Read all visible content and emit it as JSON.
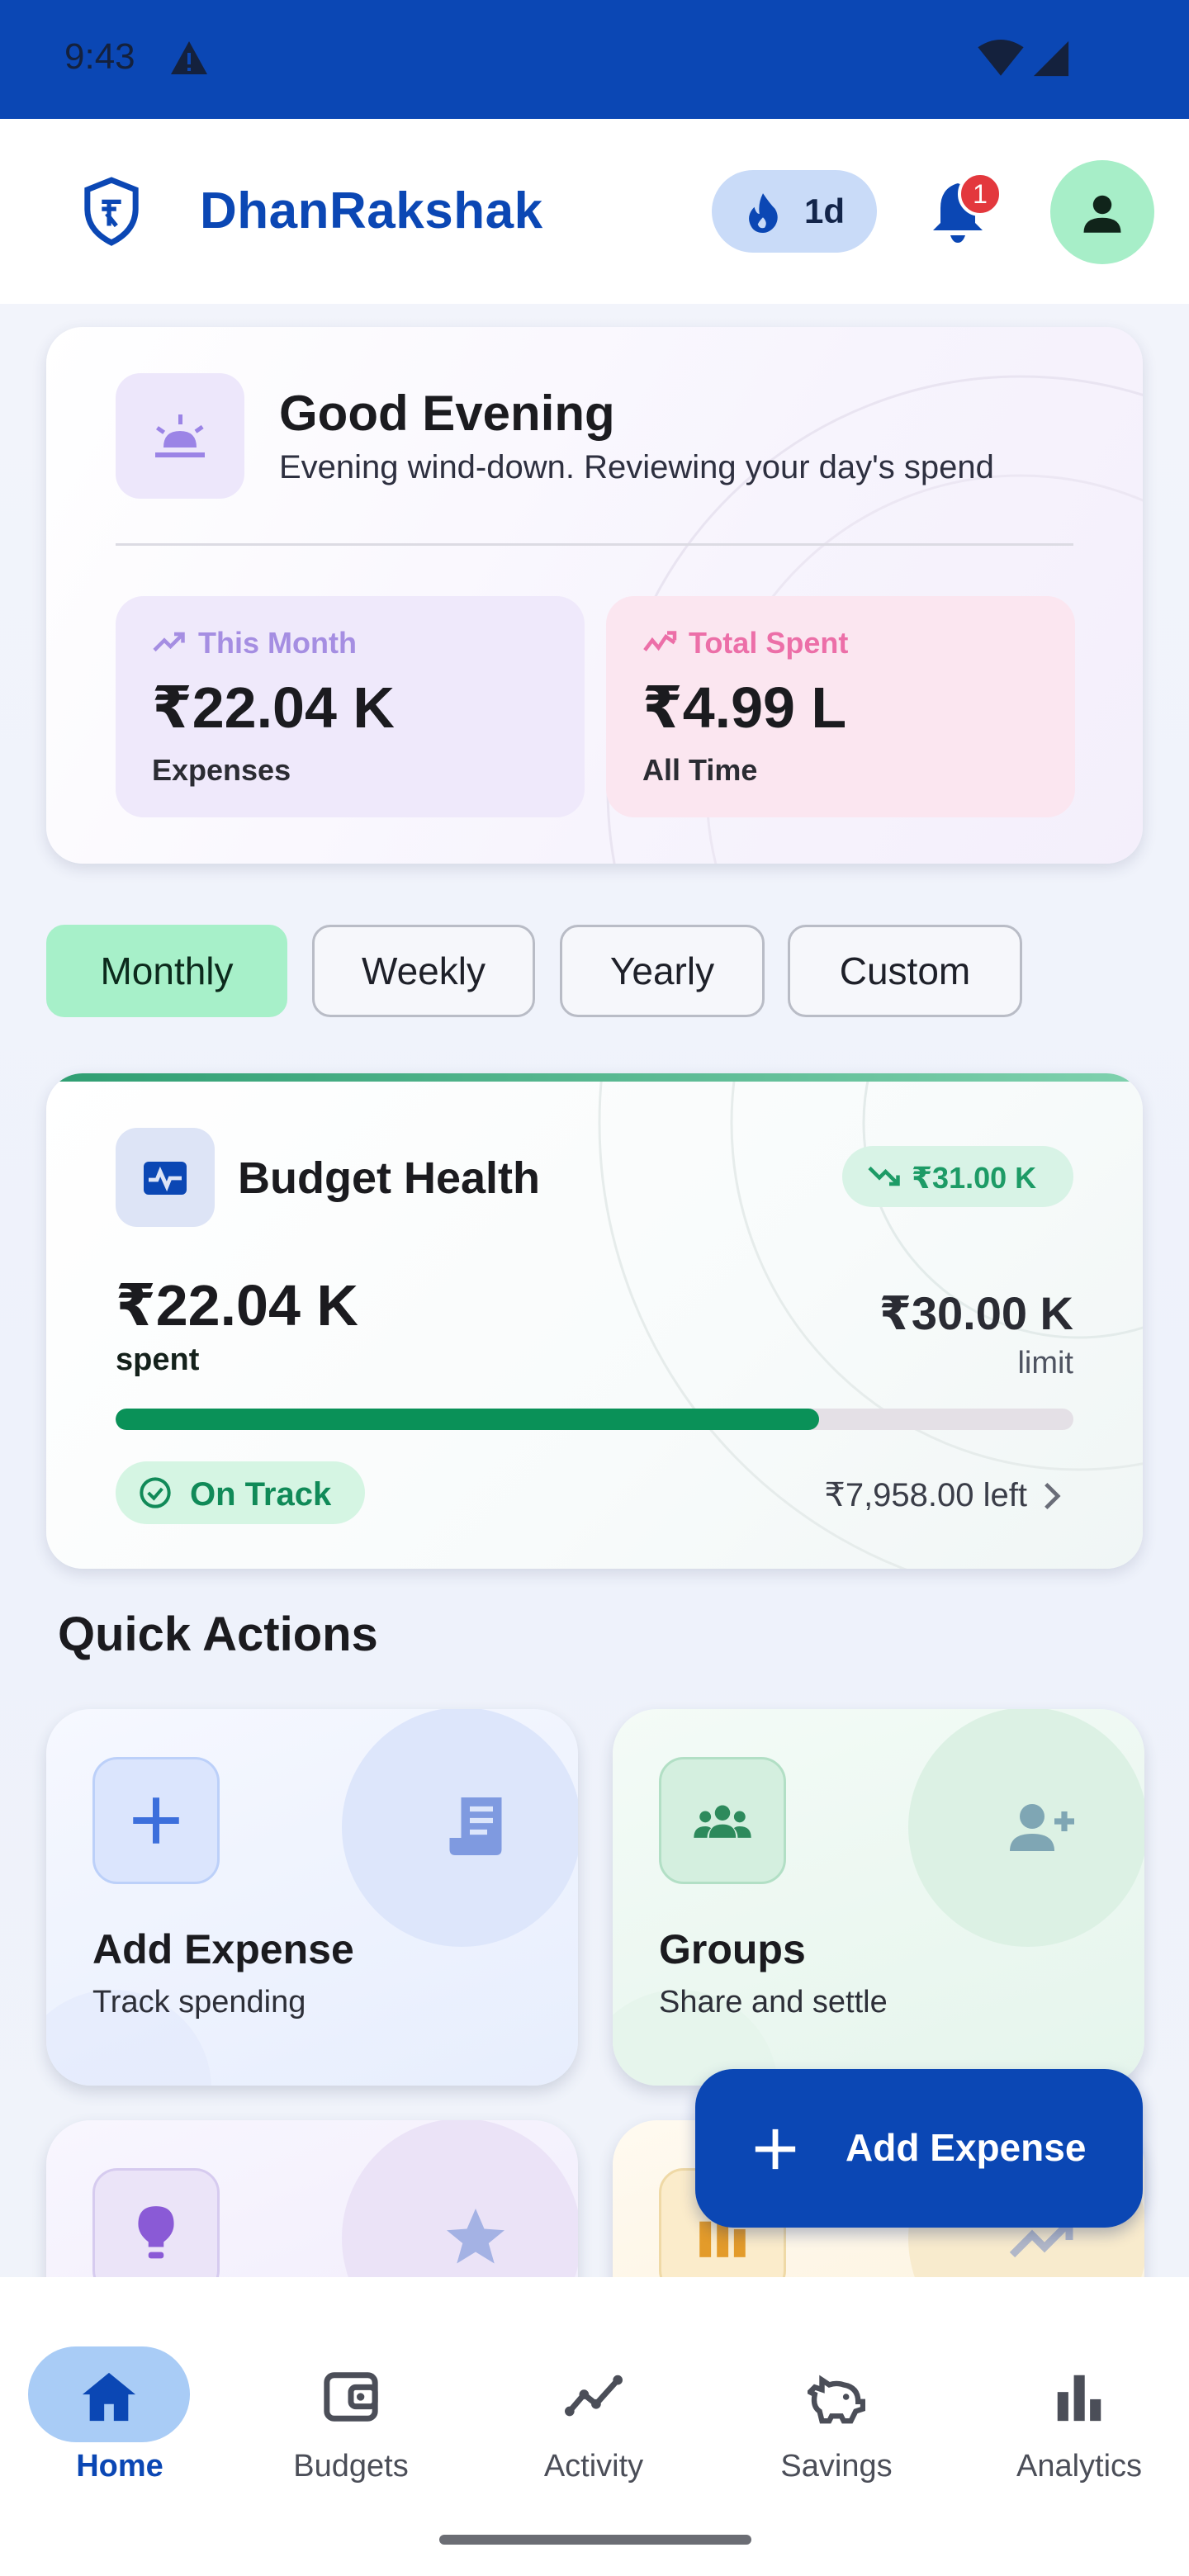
{
  "status_bar": {
    "time": "9:43"
  },
  "app_bar": {
    "title": "DhanRakshak",
    "streak": "1d",
    "notification_count": "1"
  },
  "greeting": {
    "title": "Good Evening",
    "subtitle": "Evening wind-down. Reviewing your day's spend",
    "stats": [
      {
        "label": "This Month",
        "value": "₹22.04 K",
        "caption": "Expenses",
        "color": "#a58ee2"
      },
      {
        "label": "Total Spent",
        "value": "₹4.99 L",
        "caption": "All Time",
        "color": "#ec6fa8"
      }
    ]
  },
  "filters": [
    {
      "label": "Monthly",
      "active": true
    },
    {
      "label": "Weekly",
      "active": false
    },
    {
      "label": "Yearly",
      "active": false
    },
    {
      "label": "Custom",
      "active": false
    }
  ],
  "budget": {
    "title": "Budget Health",
    "trend": "₹31.00 K",
    "spent_value": "₹22.04 K",
    "spent_label": "spent",
    "limit_value": "₹30.00 K",
    "limit_label": "limit",
    "progress": 0.7347,
    "status": "On Track",
    "left": "₹7,958.00 left"
  },
  "quick_actions": {
    "title": "Quick Actions",
    "items": [
      {
        "title": "Add Expense",
        "subtitle": "Track spending"
      },
      {
        "title": "Groups",
        "subtitle": "Share and settle"
      },
      {
        "title": "",
        "subtitle": ""
      },
      {
        "title": "",
        "subtitle": ""
      }
    ]
  },
  "fab": {
    "label": "Add Expense"
  },
  "nav": [
    {
      "label": "Home",
      "icon": "home-icon",
      "active": true
    },
    {
      "label": "Budgets",
      "icon": "wallet-icon",
      "active": false
    },
    {
      "label": "Activity",
      "icon": "activity-icon",
      "active": false
    },
    {
      "label": "Savings",
      "icon": "piggy-bank-icon",
      "active": false
    },
    {
      "label": "Analytics",
      "icon": "bar-chart-icon",
      "active": false
    }
  ],
  "colors": {
    "primary": "#0b47b4",
    "success": "#0a9158",
    "accent_green": "#a7f0c9",
    "badge_red": "#e3383d"
  }
}
